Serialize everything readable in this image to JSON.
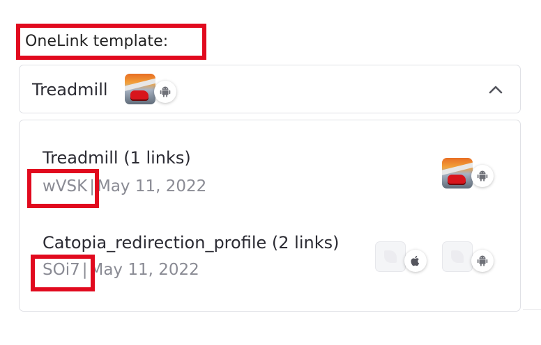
{
  "field_label": "OneLink template:",
  "select": {
    "value": "Treadmill",
    "platform_icon": "android-icon",
    "expand_icon": "chevron-up-icon"
  },
  "options": [
    {
      "title": "Treadmill (1 links)",
      "code": "wVSK",
      "separator": "|",
      "date": "May 11, 2022",
      "apps": [
        {
          "thumbnail": "treadmill-app",
          "platform_icon": "android-icon"
        }
      ]
    },
    {
      "title": "Catopia_redirection_profile (2 links)",
      "code": "SOi7",
      "separator": "|",
      "date": "May 11, 2022",
      "apps": [
        {
          "thumbnail": "placeholder-app",
          "platform_icon": "apple-icon"
        },
        {
          "thumbnail": "placeholder-app",
          "platform_icon": "android-icon"
        }
      ]
    }
  ],
  "colors": {
    "highlight": "#e10a1e",
    "border": "#dfe0e5",
    "secondary_text": "#8a8b94",
    "android_glyph": "#6f7178"
  }
}
